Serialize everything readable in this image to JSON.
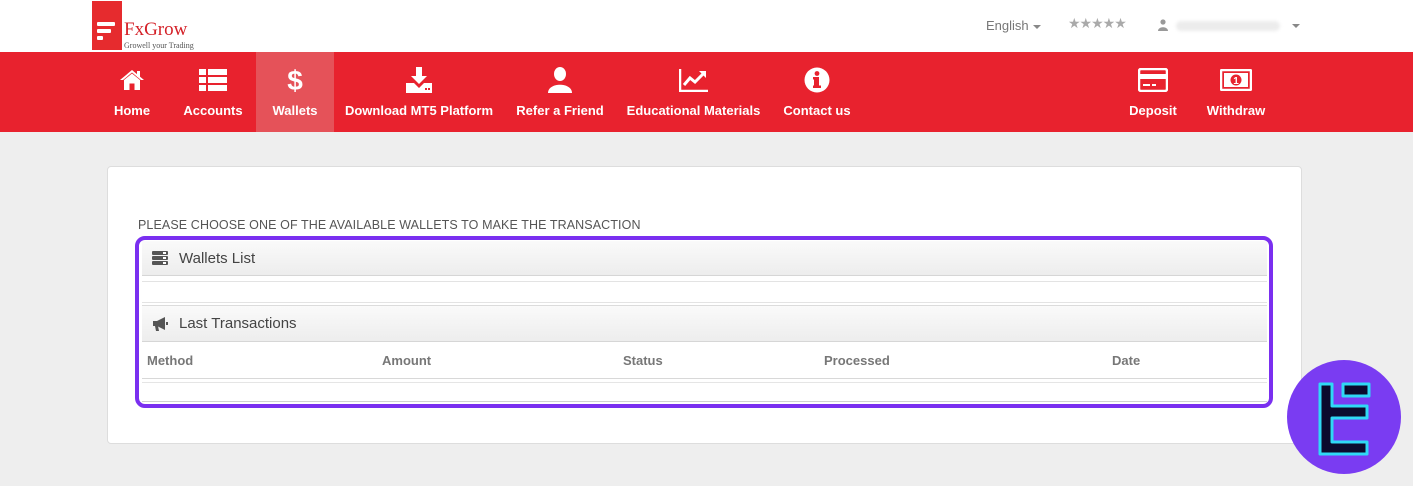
{
  "brand": {
    "name": "FxGrow",
    "tagline": "Growell your Trading",
    "color": "#d42128"
  },
  "topbar": {
    "language": "English",
    "rating_stars": "★★★★★",
    "user_icon": "user-icon"
  },
  "nav": {
    "items": [
      {
        "label": "Home",
        "icon": "home-icon"
      },
      {
        "label": "Accounts",
        "icon": "list-icon"
      },
      {
        "label": "Wallets",
        "icon": "dollar-icon",
        "active": true
      },
      {
        "label": "Download MT5 Platform",
        "icon": "download-icon"
      },
      {
        "label": "Refer a Friend",
        "icon": "user-icon"
      },
      {
        "label": "Educational Materials",
        "icon": "chart-icon"
      },
      {
        "label": "Contact us",
        "icon": "info-icon"
      }
    ],
    "right_items": [
      {
        "label": "Deposit",
        "icon": "credit-card-icon"
      },
      {
        "label": "Withdraw",
        "icon": "banknote-icon"
      }
    ],
    "background": "#e8222e"
  },
  "main": {
    "instruction": "PLEASE CHOOSE ONE OF THE AVAILABLE WALLETS TO MAKE THE TRANSACTION",
    "wallets": {
      "title": "Wallets List",
      "icon": "server-icon"
    },
    "transactions": {
      "title": "Last Transactions",
      "icon": "megaphone-icon",
      "columns": [
        "Method",
        "Amount",
        "Status",
        "Processed",
        "Date"
      ]
    },
    "highlight_color": "#7a2ff0"
  },
  "watermark": {
    "icon": "tc-logo-icon",
    "color": "#7a3cf2"
  }
}
